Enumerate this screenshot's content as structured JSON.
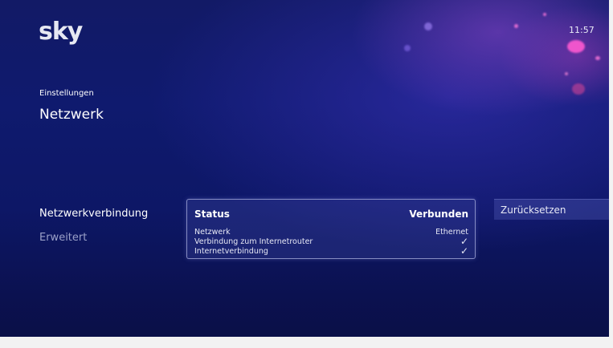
{
  "header": {
    "logo_text": "sky",
    "time": "11:57"
  },
  "page": {
    "breadcrumb": "Einstellungen",
    "title": "Netzwerk"
  },
  "menu": {
    "items": [
      {
        "label": "Netzwerkverbindung",
        "active": true
      },
      {
        "label": "Erweitert",
        "active": false
      }
    ]
  },
  "status_card": {
    "heading": "Status",
    "heading_value": "Verbunden",
    "rows": [
      {
        "label": "Netzwerk",
        "value": "Ethernet"
      },
      {
        "label": "Verbindung zum Internetrouter",
        "value": "✓"
      },
      {
        "label": "Internetverbindung",
        "value": "✓"
      }
    ]
  },
  "actions": {
    "reset_label": "Zurücksetzen"
  },
  "colors": {
    "background": "#0f1a6e",
    "accent_glow": "#c23cb4",
    "inactive_text": "#9aa0c8"
  }
}
